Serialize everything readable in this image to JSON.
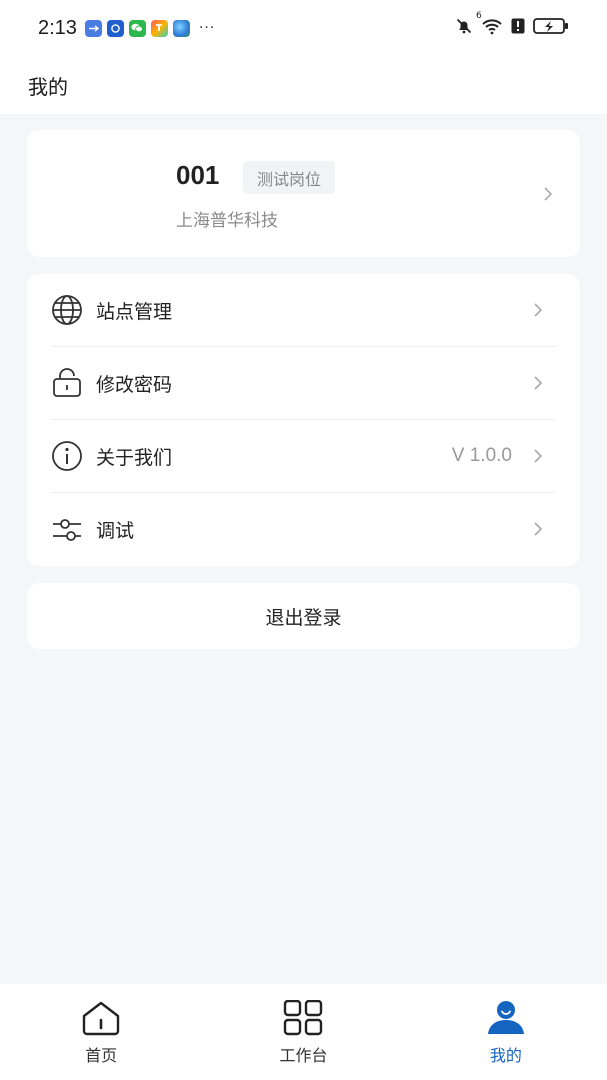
{
  "status_bar": {
    "time": "2:13",
    "more": "···",
    "network_label": "6"
  },
  "header": {
    "title": "我的"
  },
  "profile": {
    "id": "001",
    "role": "测试岗位",
    "company": "上海普华科技"
  },
  "menu": {
    "items": [
      {
        "label": "站点管理",
        "icon": "globe-icon",
        "value": ""
      },
      {
        "label": "修改密码",
        "icon": "lock-icon",
        "value": ""
      },
      {
        "label": "关于我们",
        "icon": "info-icon",
        "value": "V 1.0.0"
      },
      {
        "label": "调试",
        "icon": "sliders-icon",
        "value": ""
      }
    ]
  },
  "logout": {
    "label": "退出登录"
  },
  "tabs": [
    {
      "label": "首页",
      "icon": "home-icon",
      "active": false
    },
    {
      "label": "工作台",
      "icon": "grid-icon",
      "active": false
    },
    {
      "label": "我的",
      "icon": "user-icon",
      "active": true
    }
  ],
  "colors": {
    "accent": "#1565c0",
    "background": "#f5f6f8",
    "card": "#ffffff"
  }
}
